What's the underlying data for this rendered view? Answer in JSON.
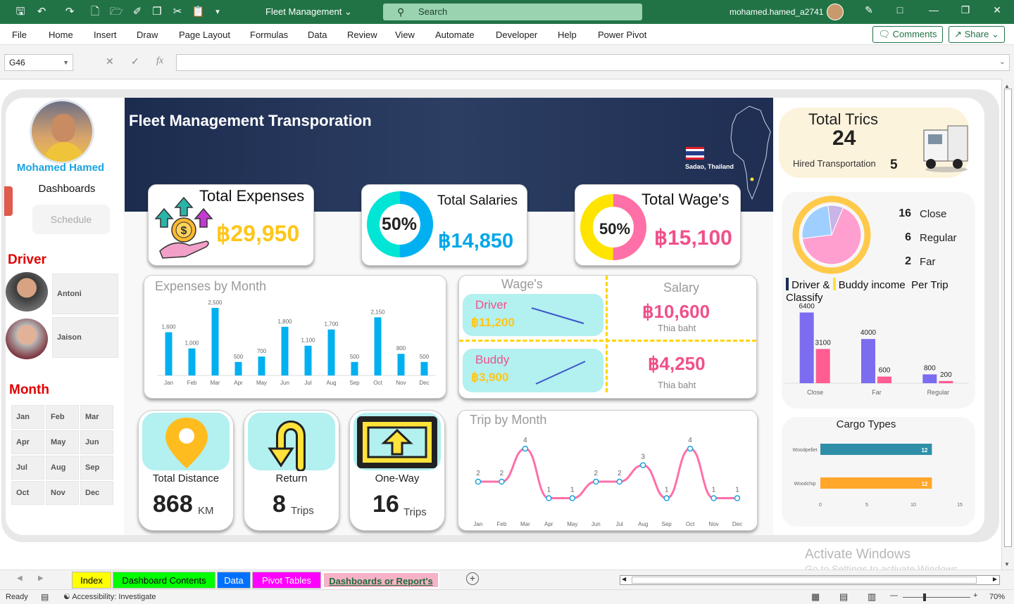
{
  "app": {
    "doc_title": "Fleet Management",
    "search_placeholder": "Search",
    "user": "mohamed.hamed_a2741"
  },
  "ribbon": {
    "tabs": [
      "File",
      "Home",
      "Insert",
      "Draw",
      "Page Layout",
      "Formulas",
      "Data",
      "Review",
      "View",
      "Automate",
      "Developer",
      "Help",
      "Power Pivot"
    ],
    "comments": "Comments",
    "share": "Share"
  },
  "formula_bar": {
    "name_box": "G46",
    "fx": "fx",
    "value": ""
  },
  "dashboard": {
    "title": "Fleet Management Transporation",
    "location": "Sadao, Thailand",
    "profile": {
      "name": "Mohamed Hamed",
      "nav_dashboards": "Dashboards",
      "nav_schedule": "Schedule"
    },
    "driver_heading": "Driver",
    "drivers": [
      "Antoni",
      "Jaison"
    ],
    "month_heading": "Month",
    "months": [
      "Jan",
      "Feb",
      "Mar",
      "Apr",
      "May",
      "Jun",
      "Jul",
      "Aug",
      "Sep",
      "Oct",
      "Nov",
      "Dec"
    ],
    "kpi": {
      "expenses": {
        "title": "Total Expenses",
        "value": "฿29,950"
      },
      "salaries": {
        "title": "Total Salaries",
        "value": "฿14,850",
        "pct": "50%",
        "pct_value": 50
      },
      "wages": {
        "title": "Total Wage's",
        "value": "฿15,100",
        "pct": "50%",
        "pct_value": 50
      }
    },
    "wages_panel": {
      "wages_title": "Wage's",
      "salary_title": "Salary",
      "driver_label": "Driver",
      "driver_wage": "฿11,200",
      "buddy_label": "Buddy",
      "buddy_wage": "฿3,900",
      "driver_salary": "฿10,600",
      "buddy_salary": "฿4,250",
      "currency_note": "Thia baht"
    },
    "tiles": {
      "distance": {
        "label": "Total Distance",
        "value": "868",
        "unit": "KM"
      },
      "return": {
        "label": "Return",
        "value": "8",
        "unit": "Trips"
      },
      "oneway": {
        "label": "One-Way",
        "value": "16",
        "unit": "Trips"
      }
    },
    "total_trips": {
      "title": "Total Trics",
      "value": "24",
      "hired_label": "Hired Transportation",
      "hired_value": "5"
    },
    "classify": {
      "items": [
        {
          "n": "16",
          "label": "Close"
        },
        {
          "n": "6",
          "label": "Regular"
        },
        {
          "n": "2",
          "label": "Far"
        }
      ],
      "legend_a": "Driver &",
      "legend_b": "Buddy income",
      "legend_c": "Per Trip",
      "legend_d": "Classify"
    },
    "cargo_title": "Cargo Types"
  },
  "chart_data": [
    {
      "type": "bar",
      "title": "Expenses by Month",
      "categories": [
        "Jan",
        "Feb",
        "Mar",
        "Apr",
        "May",
        "Jun",
        "Jul",
        "Aug",
        "Sep",
        "Oct",
        "Nov",
        "Dec"
      ],
      "values": [
        1600,
        1000,
        2500,
        500,
        700,
        1800,
        1100,
        1700,
        500,
        2150,
        800,
        500
      ],
      "value_labels": [
        "1,600",
        "1,000",
        "2,500",
        "500",
        "700",
        "1,800",
        "1,100",
        "1,700",
        "500",
        "2,150",
        "800",
        "500"
      ],
      "ylim": [
        0,
        2600
      ],
      "color": "#00b0f0"
    },
    {
      "type": "line",
      "title": "Trip by Month",
      "categories": [
        "Jan",
        "Feb",
        "Mar",
        "Apr",
        "May",
        "Jun",
        "Jul",
        "Aug",
        "Sep",
        "Oct",
        "Nov",
        "Dec"
      ],
      "values": [
        2,
        2,
        4,
        1,
        1,
        2,
        2,
        3,
        1,
        4,
        1,
        1
      ],
      "ylim": [
        0,
        4.6
      ],
      "color": "#ff6fa8"
    },
    {
      "type": "bar",
      "categories": [
        "Close",
        "Far",
        "Regular"
      ],
      "series": [
        {
          "values": [
            6400,
            4000,
            800
          ],
          "color": "#7b6cf0"
        },
        {
          "values": [
            3100,
            600,
            200
          ],
          "color": "#ff5c92"
        }
      ],
      "ylim": [
        0,
        7000
      ]
    },
    {
      "type": "bar",
      "orientation": "horizontal",
      "title": "Cargo Types",
      "categories": [
        "Woodpellet",
        "Woodchip"
      ],
      "values": [
        12,
        12
      ],
      "colors": [
        "#2f8fa8",
        "#ffa62b"
      ],
      "xlim": [
        0,
        15
      ],
      "xticks": [
        "0",
        "5",
        "10",
        "15"
      ]
    },
    {
      "type": "pie",
      "categories": [
        "Close",
        "Regular",
        "Far"
      ],
      "values": [
        16,
        6,
        2
      ],
      "colors": [
        "#ff9fd0",
        "#9fcfff",
        "#c8b4e6"
      ]
    }
  ],
  "sheet_tabs": [
    {
      "label": "Index",
      "color": "#ffff00"
    },
    {
      "label": "Dashboard Contents",
      "color": "#00ff00"
    },
    {
      "label": "Data",
      "color": "#0070ff"
    },
    {
      "label": "Pivot Tables",
      "color": "#ff00ff"
    },
    {
      "label": "Dashboards or Report's",
      "color": "#f6b2c7"
    }
  ],
  "status": {
    "ready": "Ready",
    "accessibility": "Accessibility: Investigate",
    "zoom": "70%"
  },
  "watermark": {
    "line1": "Activate Windows",
    "line2": "Go to Settings to activate Windows."
  }
}
